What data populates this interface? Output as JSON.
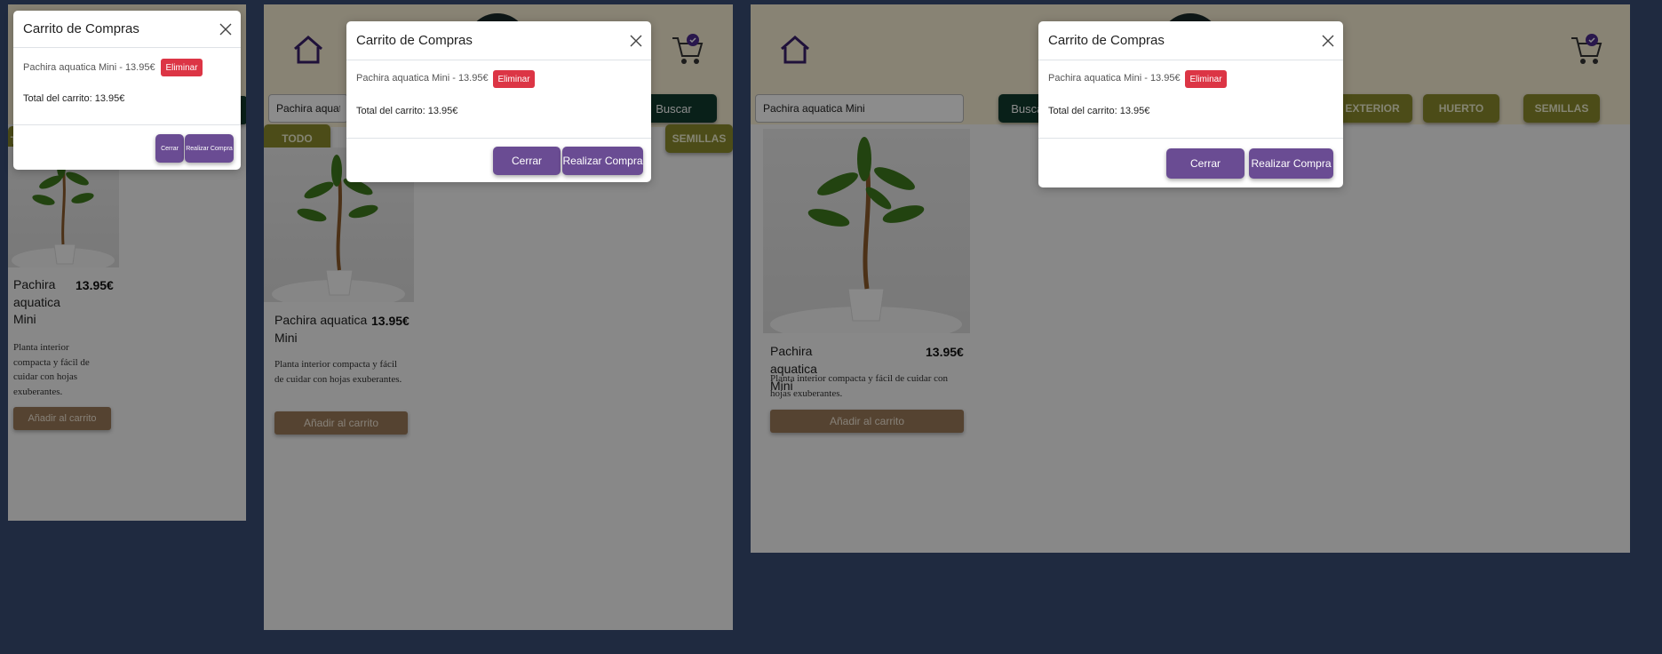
{
  "search": {
    "value": "Pachira aquatica Mini",
    "button_label": "Buscar"
  },
  "categories": [
    "TODO",
    "EXTERIOR",
    "HUERTO",
    "SEMILLAS"
  ],
  "product": {
    "name": "Pachira aquatica Mini",
    "price": "13.95€",
    "description": "Planta interior compacta y fácil de cuidar con hojas exuberantes.",
    "add_label": "Añadir al carrito"
  },
  "modal": {
    "title": "Carrito de Compras",
    "item_text": "Pachira aquatica Mini - 13.95€",
    "remove_label": "Eliminar",
    "total_text": "Total del carrito: 13.95€",
    "close_label": "Cerrar",
    "checkout_label": "Realizar Compra"
  },
  "colors": {
    "page_bg": "#1f2a40",
    "header_bg": "#f7efd4",
    "accent_purple": "#6a4c93",
    "danger_red": "#dc3545",
    "search_green": "#123b2f",
    "category_olive": "#8a8a2d",
    "add_brown": "#9c7a5a"
  },
  "icons": [
    "home-icon",
    "cart-icon",
    "close-icon"
  ]
}
